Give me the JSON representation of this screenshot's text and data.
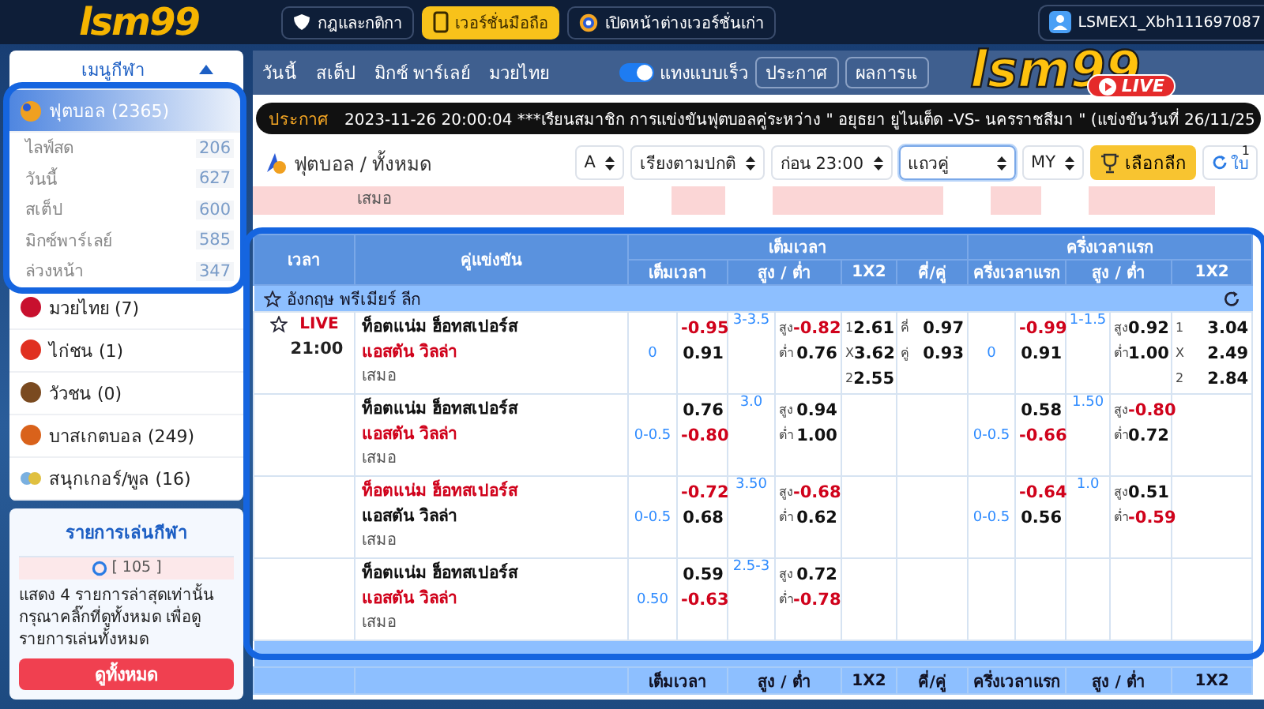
{
  "header": {
    "logo": "lsm99",
    "buttons": [
      {
        "label": "กฎและกติกา",
        "selected": false
      },
      {
        "label": "เวอร์ชั่นมือถือ",
        "selected": true
      },
      {
        "label": "เปิดหน้าต่างเวอร์ชั่นเก่า",
        "selected": false
      }
    ],
    "user": "LSMEX1_Xbh111697087"
  },
  "overlay_logo": {
    "logo": "lsm99",
    "badge": "LIVE"
  },
  "sidebar": {
    "title": "เมนูกีฬา",
    "expanded": true,
    "sports": [
      {
        "label": "ฟุตบอล (2365)",
        "selected": true,
        "children": [
          {
            "label": "ไลฟ์สด",
            "count": "206"
          },
          {
            "label": "วันนี้",
            "count": "627"
          },
          {
            "label": "สเต็ป",
            "count": "600"
          },
          {
            "label": "มิกซ์พาร์เลย์",
            "count": "585"
          },
          {
            "label": "ล่วงหน้า",
            "count": "347"
          }
        ]
      },
      {
        "label": "มวยไทย (7)",
        "selected": false
      },
      {
        "label": "ไก่ชน (1)",
        "selected": false
      },
      {
        "label": "วัวชน (0)",
        "selected": false
      },
      {
        "label": "บาสเกตบอล (249)",
        "selected": false
      },
      {
        "label": "สนุกเกอร์/พูล (16)",
        "selected": false
      }
    ]
  },
  "bets_panel": {
    "title": "รายการเล่นกีฬา",
    "count": "[ 105 ]",
    "message": "แสดง 4 รายการล่าสุดเท่านั้น กรุณาคลิ๊กที่ดูทั้งหมด เพื่อดูรายการเล่นทั้งหมด",
    "button": "ดูทั้งหมด"
  },
  "tabs": [
    "วันนี้",
    "สเต็ป",
    "มิกซ์ พาร์เลย์",
    "มวยไทย"
  ],
  "quick_bet": {
    "label": "แทงแบบเร็ว",
    "on": true
  },
  "top_buttons": [
    "ประกาศ",
    "ผลการแ"
  ],
  "announcement": {
    "label": "ประกาศ",
    "text": "2023-11-26 20:00:04 ***เรียนสมาชิก การแข่งขันฟุตบอลคู่ระหว่าง \" อยุธยา ยูไนเต็ด -VS- นครราชสีมา \" (แข่งขันวันที่ 26/11/25"
  },
  "title": "ฟุตบอล / ทั้งหมด",
  "filters": [
    {
      "value": "A",
      "focused": false
    },
    {
      "value": "เรียงตามปกติ",
      "focused": false
    },
    {
      "value": "ก่อน 23:00",
      "focused": false
    },
    {
      "value": "แถวคู่",
      "focused": true
    },
    {
      "value": "MY",
      "focused": false
    }
  ],
  "league_button": "เลือกลีก",
  "refresh": {
    "badge": "1",
    "label": "ใบ"
  },
  "ghost_row": {
    "label": "เสมอ"
  },
  "table": {
    "columns": [
      "เวลา",
      "คู่แข่งขัน"
    ],
    "groups": [
      "เต็มเวลา",
      "ครึ่งเวลาแรก"
    ],
    "sub_columns": [
      "เต็มเวลา",
      "สูง / ต่ำ",
      "1X2",
      "คี่/คู่",
      "ครึ่งเวลาแรก",
      "สูง / ต่ำ",
      "1X2"
    ],
    "league": "อังกฤษ พรีเมียร์ ลีก",
    "rows": [
      {
        "star": true,
        "live": "LIVE",
        "time": "21:00",
        "teams": [
          {
            "name": "ท็อตแน่ม ฮ็อทสเปอร์ส",
            "highlight": false
          },
          {
            "name": "แอสตัน วิลล่า",
            "highlight": true
          }
        ],
        "draw": "เสมอ",
        "ft": {
          "hdp": "0",
          "odds": [
            "-0.95",
            "0.91"
          ],
          "ou_line": "3-3.5",
          "ou": [
            {
              "label": "สูง",
              "value": "-0.82"
            },
            {
              "label": "ต่ำ",
              "value": "0.76"
            }
          ],
          "x12": [
            {
              "label": "1",
              "value": "2.61"
            },
            {
              "label": "X",
              "value": "3.62"
            },
            {
              "label": "2",
              "value": "2.55"
            }
          ],
          "oe": [
            {
              "label": "คี่",
              "value": "0.97"
            },
            {
              "label": "คู่",
              "value": "0.93"
            }
          ]
        },
        "ht": {
          "hdp": "0",
          "odds": [
            "-0.99",
            "0.91"
          ],
          "ou_line": "1-1.5",
          "ou": [
            {
              "label": "สูง",
              "value": "0.92"
            },
            {
              "label": "ต่ำ",
              "value": "1.00"
            }
          ],
          "x12": [
            {
              "label": "1",
              "value": "3.04"
            },
            {
              "label": "X",
              "value": "2.49"
            },
            {
              "label": "2",
              "value": "2.84"
            }
          ]
        }
      },
      {
        "star": false,
        "teams": [
          {
            "name": "ท็อตแน่ม ฮ็อทสเปอร์ส",
            "highlight": false
          },
          {
            "name": "แอสตัน วิลล่า",
            "highlight": true
          }
        ],
        "draw": "เสมอ",
        "ft": {
          "hdp": "0-0.5",
          "odds": [
            "0.76",
            "-0.80"
          ],
          "ou_line": "3.0",
          "ou": [
            {
              "label": "สูง",
              "value": "0.94"
            },
            {
              "label": "ต่ำ",
              "value": "1.00"
            }
          ]
        },
        "ht": {
          "hdp": "0-0.5",
          "odds": [
            "0.58",
            "-0.66"
          ],
          "ou_line": "1.50",
          "ou": [
            {
              "label": "สูง",
              "value": "-0.80"
            },
            {
              "label": "ต่ำ",
              "value": "0.72"
            }
          ]
        }
      },
      {
        "star": false,
        "teams": [
          {
            "name": "ท็อตแน่ม ฮ็อทสเปอร์ส",
            "highlight": true
          },
          {
            "name": "แอสตัน วิลล่า",
            "highlight": false
          }
        ],
        "draw": "เสมอ",
        "ft": {
          "hdp": "0-0.5",
          "odds": [
            "-0.72",
            "0.68"
          ],
          "ou_line": "3.50",
          "ou": [
            {
              "label": "สูง",
              "value": "-0.68"
            },
            {
              "label": "ต่ำ",
              "value": "0.62"
            }
          ]
        },
        "ht": {
          "hdp": "0-0.5",
          "odds": [
            "-0.64",
            "0.56"
          ],
          "ou_line": "1.0",
          "ou": [
            {
              "label": "สูง",
              "value": "0.51"
            },
            {
              "label": "ต่ำ",
              "value": "-0.59"
            }
          ]
        }
      },
      {
        "star": false,
        "teams": [
          {
            "name": "ท็อตแน่ม ฮ็อทสเปอร์ส",
            "highlight": false
          },
          {
            "name": "แอสตัน วิลล่า",
            "highlight": true
          }
        ],
        "draw": "เสมอ",
        "ft": {
          "hdp": "0.50",
          "odds": [
            "0.59",
            "-0.63"
          ],
          "ou_line": "2.5-3",
          "ou": [
            {
              "label": "สูง",
              "value": "0.72"
            },
            {
              "label": "ต่ำ",
              "value": "-0.78"
            }
          ]
        }
      }
    ],
    "next_sub_columns": [
      "เต็มเวลา",
      "สูง / ต่ำ",
      "1X2",
      "คี่/คู่",
      "ครึ่งเวลาแรก",
      "สูง / ต่ำ",
      "1X2"
    ]
  }
}
